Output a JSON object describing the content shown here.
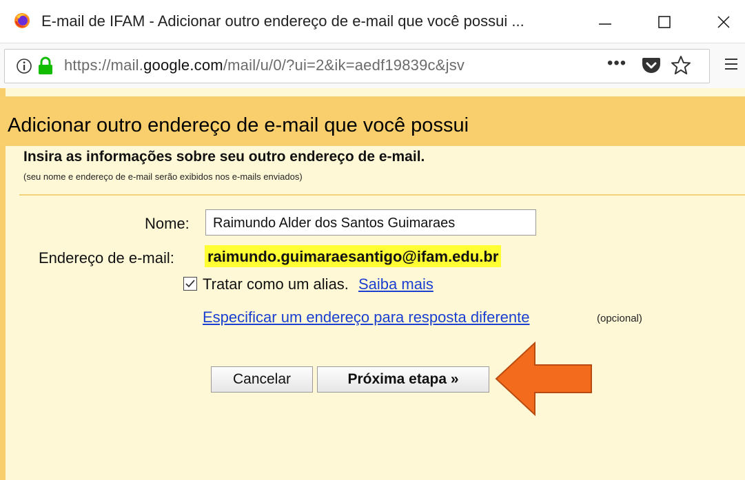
{
  "window": {
    "title": "E-mail de IFAM - Adicionar outro endereço de e-mail que você possui ...",
    "controls": [
      "minimize",
      "maximize",
      "close"
    ]
  },
  "toolbar": {
    "url_prefix": "https://mail.",
    "url_domain": "google.com",
    "url_suffix": "/mail/u/0/?ui=2&ik=aedf19839c&jsv",
    "more_label": "•••"
  },
  "dialog": {
    "title": "Adicionar outro endereço de e-mail que você possui",
    "intro_title": "Insira as informações sobre seu outro endereço de e-mail.",
    "intro_subtitle": "(seu nome e endereço de e-mail serão exibidos nos e-mails enviados)",
    "name_label": "Nome:",
    "name_value": "Raimundo Alder dos Santos Guimaraes",
    "email_label": "Endereço de e-mail:",
    "email_value": "raimundo.guimaraesantigo@ifam.edu.br",
    "alias_checked": true,
    "alias_label": "Tratar como um alias.",
    "learn_more_link": "Saiba mais",
    "reply_link": "Especificar um endereço para resposta diferente",
    "optional_label": "(opcional)",
    "cancel_label": "Cancelar",
    "next_label": "Próxima etapa »"
  },
  "colors": {
    "header": "#f9cf6e",
    "panel": "#fff8d6",
    "highlight": "#ffff33",
    "link": "#1a3fd0",
    "arrow": "#f36b1c"
  }
}
